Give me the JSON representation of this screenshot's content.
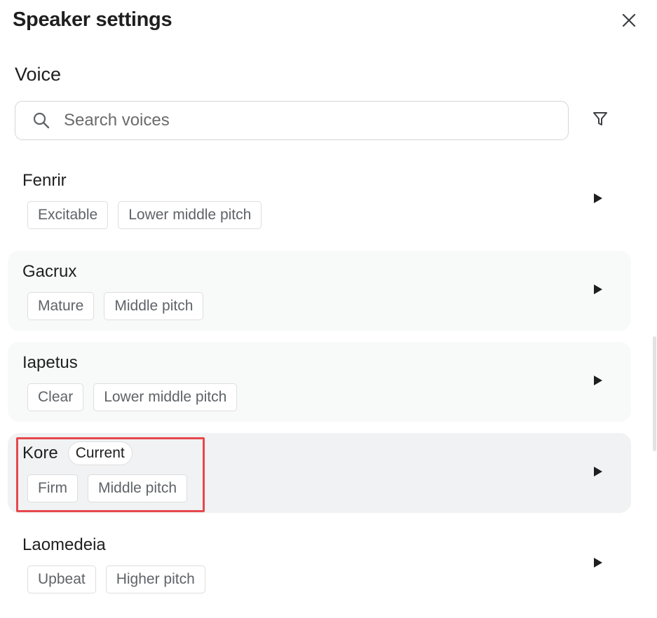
{
  "header": {
    "title": "Speaker settings"
  },
  "icons": {
    "close": "close-icon",
    "search": "search-icon",
    "filter": "filter-icon",
    "play": "play-icon"
  },
  "section": {
    "title": "Voice"
  },
  "search": {
    "placeholder": "Search voices",
    "value": ""
  },
  "voices": [
    {
      "name": "Fenrir",
      "tags": [
        "Excitable",
        "Lower middle pitch"
      ],
      "current": false
    },
    {
      "name": "Gacrux",
      "tags": [
        "Mature",
        "Middle pitch"
      ],
      "current": false
    },
    {
      "name": "Iapetus",
      "tags": [
        "Clear",
        "Lower middle pitch"
      ],
      "current": false
    },
    {
      "name": "Kore",
      "badge": "Current",
      "tags": [
        "Firm",
        "Middle pitch"
      ],
      "current": true
    },
    {
      "name": "Laomedeia",
      "tags": [
        "Upbeat",
        "Higher pitch"
      ],
      "current": false
    }
  ],
  "colors": {
    "highlight": "#e5484d",
    "card_bg": "#f8f9f9",
    "current_bg": "#f1f2f3"
  }
}
